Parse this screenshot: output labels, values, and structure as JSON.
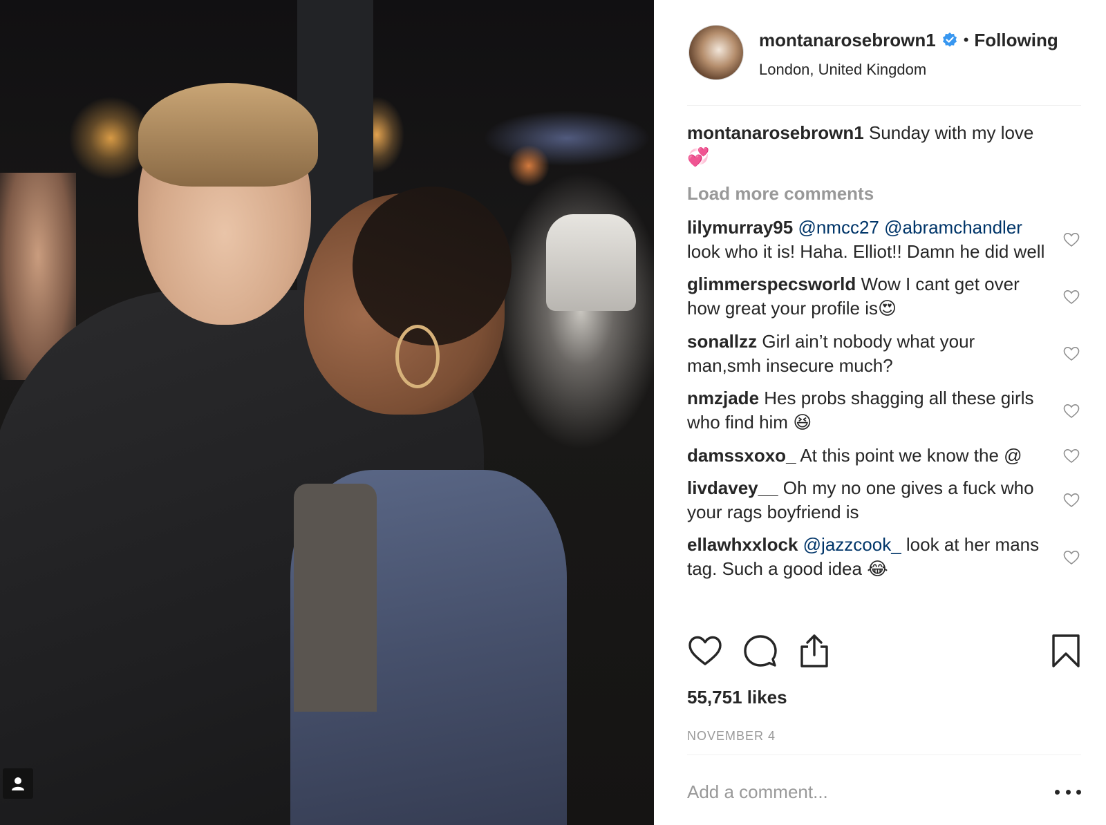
{
  "post": {
    "username": "montanarosebrown1",
    "follow_separator": "•",
    "follow_state": "Following",
    "location": "London, United Kingdom"
  },
  "caption": {
    "username": "montanarosebrown1",
    "text": "Sunday with my love",
    "emoji": "💞"
  },
  "load_more_label": "Load more comments",
  "comments": [
    {
      "username": "lilymurray95",
      "mention1": "@nmcc27",
      "mention2": "@abramchandler",
      "text": "look who it is! Haha. Elliot!! Damn he did well"
    },
    {
      "username": "glimmerspecsworld",
      "text": "Wow I cant get over how great your profile is",
      "emoji": "😍"
    },
    {
      "username": "sonallzz",
      "text": "Girl ain’t nobody what your man,smh insecure much?"
    },
    {
      "username": "nmzjade",
      "text": "Hes probs shagging all these girls who find him",
      "emoji": "😆"
    },
    {
      "username": "damssxoxo_",
      "text": "At this point we know the @"
    },
    {
      "username": "livdavey__",
      "text": "Oh my no one gives a fuck who your rags boyfriend is"
    },
    {
      "username": "ellawhxxlock",
      "mention1": "@jazzcook_",
      "text": "look at her mans tag. Such a good idea",
      "emoji": "😂"
    }
  ],
  "likes_text": "55,751 likes",
  "date_text": "NOVEMBER 4",
  "add_comment_placeholder": "Add a comment...",
  "colors": {
    "accent_link": "#003569",
    "verified_blue": "#3897f0",
    "muted_text": "#999999",
    "text": "#262626",
    "divider": "#efefef"
  },
  "icons": {
    "like": "heart-outline-icon",
    "comment": "speech-bubble-icon",
    "share": "share-upload-icon",
    "save": "bookmark-icon",
    "comment_like": "small-heart-icon",
    "tagged": "person-tag-icon",
    "more": "ellipsis-icon",
    "verified": "verified-badge-icon"
  }
}
